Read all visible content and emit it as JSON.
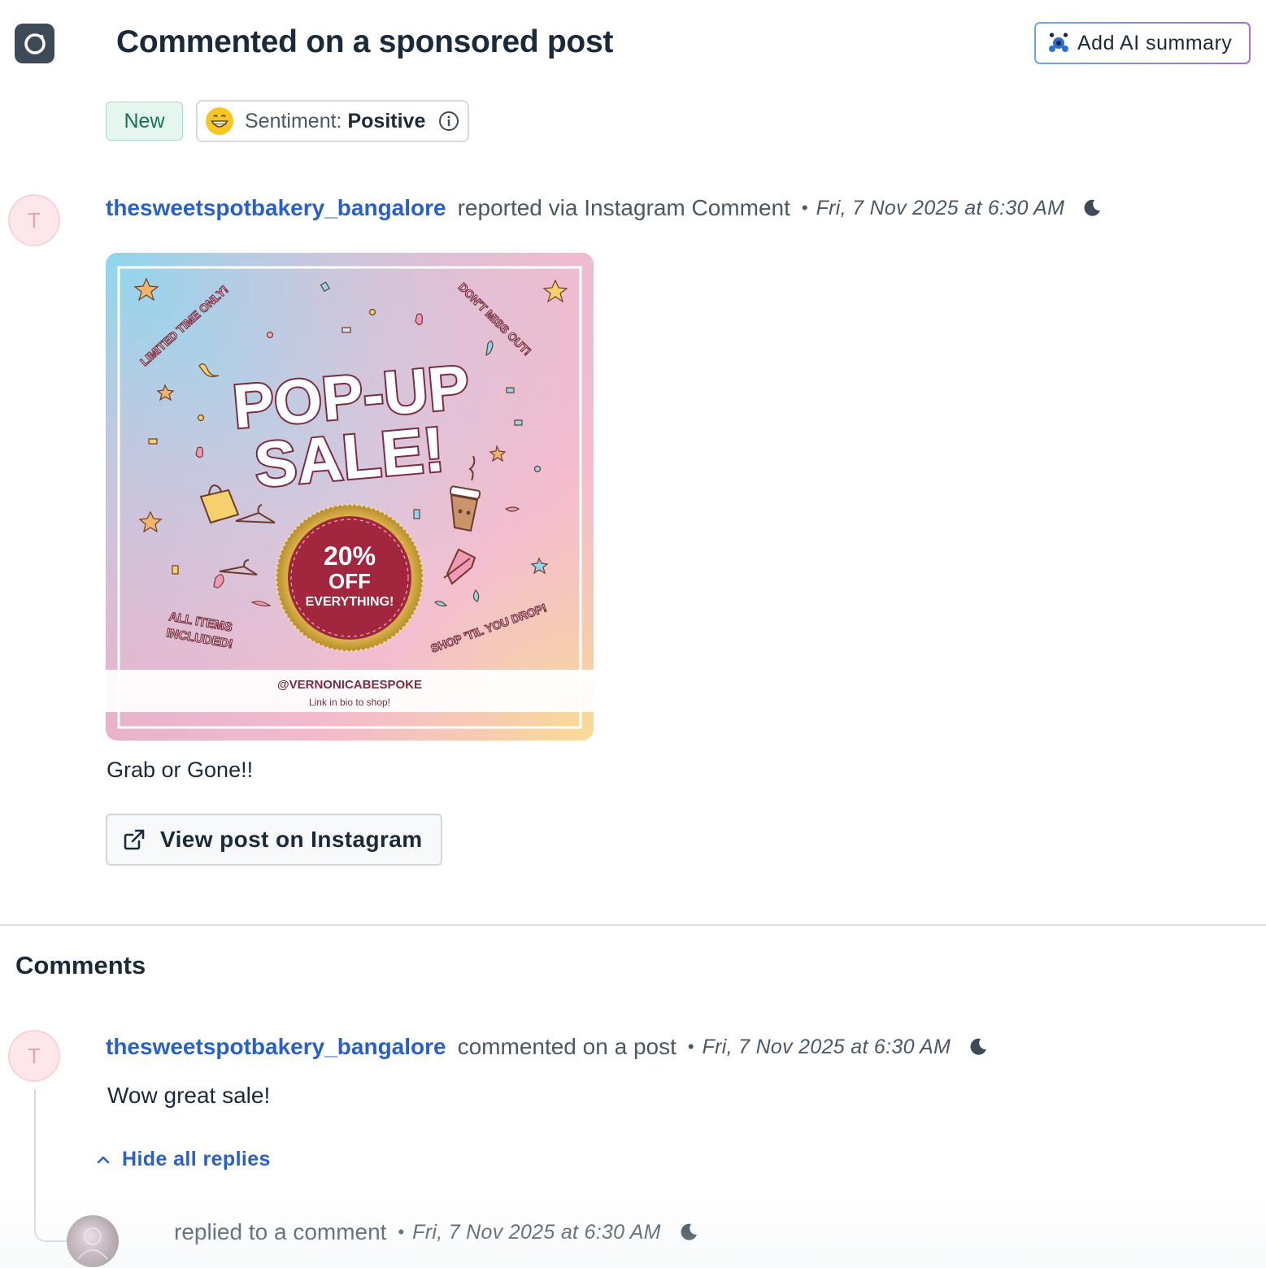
{
  "header": {
    "icon": "instagram-icon",
    "title": "Commented on a sponsored post",
    "ai_summary_label": "Add AI summary"
  },
  "tags": {
    "status": "New",
    "sentiment_label": "Sentiment:",
    "sentiment_value": "Positive"
  },
  "post": {
    "author": "thesweetspotbakery_bangalore",
    "action": "reported via Instagram Comment",
    "timestamp": "Fri, 7 Nov 2025 at 6:30 AM",
    "avatar_letter": "T",
    "image": {
      "corner_top_left": "LIMITED TIME ONLY!",
      "corner_top_right": "DON'T MISS OUT!",
      "headline_1": "POP-UP",
      "headline_2": "SALE!",
      "badge_1": "20%",
      "badge_2": "OFF",
      "badge_3": "EVERYTHING!",
      "corner_bottom_left_1": "ALL ITEMS",
      "corner_bottom_left_2": "INCLUDED!",
      "corner_bottom_right": "SHOP 'TIL YOU DROP!",
      "handle": "@VERNONICABESPOKE",
      "link_text": "Link in bio to shop!"
    },
    "caption": "Grab or Gone!!",
    "view_button_label": "View post on Instagram"
  },
  "comments": {
    "heading": "Comments",
    "items": [
      {
        "author": "thesweetspotbakery_bangalore",
        "action": "commented on a post",
        "timestamp": "Fri, 7 Nov 2025 at 6:30 AM",
        "avatar_letter": "T",
        "body": "Wow great sale!",
        "hide_replies_label": "Hide all replies",
        "reply": {
          "action": "replied to a comment",
          "timestamp": "Fri, 7 Nov 2025 at 6:30 AM"
        }
      }
    ]
  },
  "colors": {
    "link_blue": "#2860c8",
    "text_dark": "#1b2a3a",
    "new_tag_green": "#17734e",
    "sale_badge_maroon": "#a3263f"
  }
}
